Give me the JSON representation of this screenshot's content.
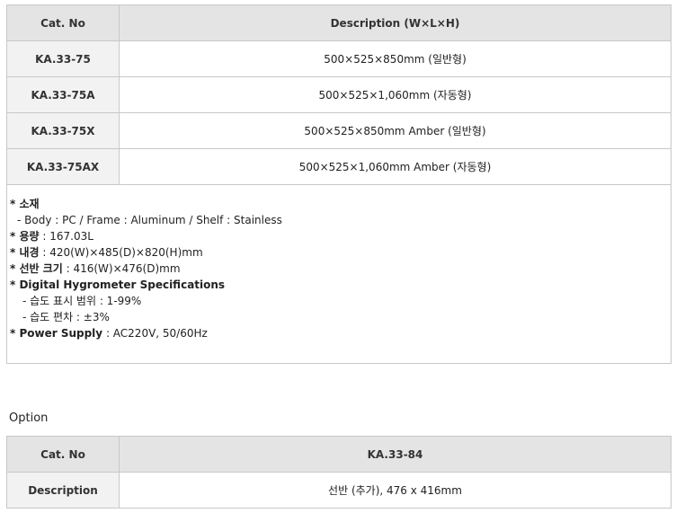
{
  "main_table": {
    "header": {
      "cat_no": "Cat. No",
      "description": "Description (W×L×H)"
    },
    "rows": [
      {
        "cat_no": "KA.33-75",
        "description": "500×525×850mm (일반형)"
      },
      {
        "cat_no": "KA.33-75A",
        "description": "500×525×1,060mm (자동형)"
      },
      {
        "cat_no": "KA.33-75X",
        "description": "500×525×850mm Amber (일반형)"
      },
      {
        "cat_no": "KA.33-75AX",
        "description": "500×525×1,060mm Amber (자동형)"
      }
    ],
    "specs": {
      "material_key": "* 소재",
      "material_detail": "- Body : PC / Frame : Aluminum / Shelf : Stainless",
      "capacity_key": "* 용량",
      "capacity_val": " : 167.03L",
      "inner_key": "* 내경",
      "inner_val": " : 420(W)×485(D)×820(H)mm",
      "shelf_key": "* 선반 크기",
      "shelf_val": " : 416(W)×476(D)mm",
      "hygro_key": "* Digital Hygrometer Specifications",
      "hygro_line1": "- 습도 표시 범위 : 1-99%",
      "hygro_line2": "- 습도 편차 : ±3%",
      "power_key": "* Power Supply",
      "power_val": " : AC220V, 50/60Hz"
    }
  },
  "option": {
    "title": "Option",
    "rows": [
      {
        "key": "Cat. No",
        "value": "KA.33-84"
      },
      {
        "key": "Description",
        "value": "선반 (추가), 476 x 416mm"
      }
    ]
  }
}
